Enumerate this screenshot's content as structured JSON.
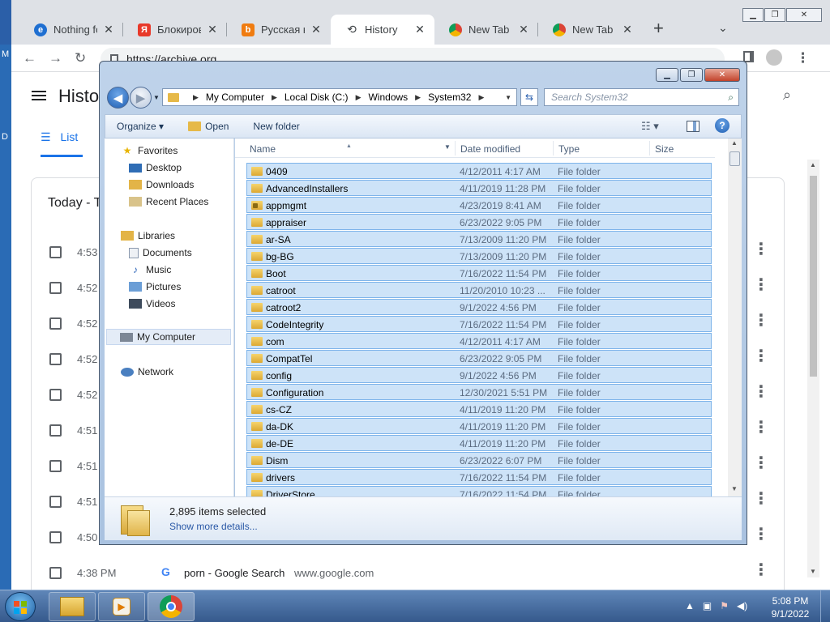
{
  "desktop": {
    "edge_letters": [
      "M",
      "D"
    ]
  },
  "browser": {
    "tabs": [
      {
        "title": "Nothing fou",
        "icon": "edge-icon"
      },
      {
        "title": "Блокировк",
        "icon": "yandex-icon"
      },
      {
        "title": "Русская кла",
        "icon": "b-icon"
      },
      {
        "title": "History",
        "icon": "history-icon",
        "active": true
      },
      {
        "title": "New Tab",
        "icon": "chrome-icon"
      },
      {
        "title": "New Tab",
        "icon": "chrome-icon"
      }
    ],
    "tab_close": "✕",
    "new_tab": "+",
    "tab_list": "⌄",
    "window_controls": {
      "minimize": "▁",
      "restore": "❐",
      "close": "✕"
    },
    "toolbar": {
      "back": "←",
      "forward": "→",
      "reload": "↻",
      "url": "https://archive.org",
      "menu": "⋮"
    },
    "page": {
      "title": "Histo",
      "list_tab": "List",
      "day_title": "Today - T",
      "search_glyph": "⌕",
      "rows": [
        {
          "time": "4:53"
        },
        {
          "time": "4:52"
        },
        {
          "time": "4:52"
        },
        {
          "time": "4:52"
        },
        {
          "time": "4:52"
        },
        {
          "time": "4:51"
        },
        {
          "time": "4:51"
        },
        {
          "time": "4:51"
        },
        {
          "time": "4:50"
        },
        {
          "time": "4:38 PM",
          "favicon": "G",
          "title": "porn - Google Search",
          "domain": "www.google.com"
        }
      ],
      "row_menu": "⋮"
    }
  },
  "explorer": {
    "window_controls": {
      "minimize": "▁",
      "restore": "❐",
      "close": "✕"
    },
    "nav": {
      "back": "◀",
      "forward": "▶",
      "dropdown": "▼"
    },
    "address": [
      "My Computer",
      "Local Disk (C:)",
      "Windows",
      "System32"
    ],
    "address_sep": "▶",
    "address_dropdown": "▼",
    "refresh": "⇆",
    "search_placeholder": "Search System32",
    "search_glyph": "⌕",
    "commands": {
      "organize": "Organize ▾",
      "open": "Open",
      "new_folder": "New folder"
    },
    "views_glyph": "☷ ▾",
    "help": "?",
    "sidebar": {
      "favorites": {
        "header": "Favorites",
        "items": [
          "Desktop",
          "Downloads",
          "Recent Places"
        ]
      },
      "libraries": {
        "header": "Libraries",
        "items": [
          "Documents",
          "Music",
          "Pictures",
          "Videos"
        ]
      },
      "computer": "My Computer",
      "network": "Network"
    },
    "columns": {
      "name": "Name",
      "date": "Date modified",
      "type": "Type",
      "size": "Size"
    },
    "sort_glyph": "▲",
    "filter_glyph": "▼",
    "files": [
      {
        "name": "0409",
        "date": "4/12/2011 4:17 AM",
        "type": "File folder"
      },
      {
        "name": "AdvancedInstallers",
        "date": "4/11/2019 11:28 PM",
        "type": "File folder"
      },
      {
        "name": "appmgmt",
        "date": "4/23/2019 8:41 AM",
        "type": "File folder",
        "locked": true
      },
      {
        "name": "appraiser",
        "date": "6/23/2022 9:05 PM",
        "type": "File folder"
      },
      {
        "name": "ar-SA",
        "date": "7/13/2009 11:20 PM",
        "type": "File folder"
      },
      {
        "name": "bg-BG",
        "date": "7/13/2009 11:20 PM",
        "type": "File folder"
      },
      {
        "name": "Boot",
        "date": "7/16/2022 11:54 PM",
        "type": "File folder"
      },
      {
        "name": "catroot",
        "date": "11/20/2010 10:23 ...",
        "type": "File folder"
      },
      {
        "name": "catroot2",
        "date": "9/1/2022 4:56 PM",
        "type": "File folder"
      },
      {
        "name": "CodeIntegrity",
        "date": "7/16/2022 11:54 PM",
        "type": "File folder"
      },
      {
        "name": "com",
        "date": "4/12/2011 4:17 AM",
        "type": "File folder"
      },
      {
        "name": "CompatTel",
        "date": "6/23/2022 9:05 PM",
        "type": "File folder"
      },
      {
        "name": "config",
        "date": "9/1/2022 4:56 PM",
        "type": "File folder"
      },
      {
        "name": "Configuration",
        "date": "12/30/2021 5:51 PM",
        "type": "File folder"
      },
      {
        "name": "cs-CZ",
        "date": "4/11/2019 11:20 PM",
        "type": "File folder"
      },
      {
        "name": "da-DK",
        "date": "4/11/2019 11:20 PM",
        "type": "File folder"
      },
      {
        "name": "de-DE",
        "date": "4/11/2019 11:20 PM",
        "type": "File folder"
      },
      {
        "name": "Dism",
        "date": "6/23/2022 6:07 PM",
        "type": "File folder"
      },
      {
        "name": "drivers",
        "date": "7/16/2022 11:54 PM",
        "type": "File folder"
      },
      {
        "name": "DriverStore",
        "date": "7/16/2022 11:54 PM",
        "type": "File folder"
      }
    ],
    "scroll_glyphs": {
      "up": "▲",
      "down": "▼"
    },
    "status": {
      "selected": "2,895 items selected",
      "details_link": "Show more details..."
    }
  },
  "taskbar": {
    "apps": [
      {
        "name": "Windows Explorer",
        "icon": "folder-icon"
      },
      {
        "name": "Media Player",
        "icon": "media-player-icon"
      },
      {
        "name": "Google Chrome",
        "icon": "chrome-icon",
        "active": true
      }
    ],
    "tray": {
      "show_hidden": "▲",
      "network": "▣",
      "action_center": "⚑",
      "volume": "◀)"
    },
    "clock": {
      "time": "5:08 PM",
      "date": "9/1/2022"
    }
  }
}
